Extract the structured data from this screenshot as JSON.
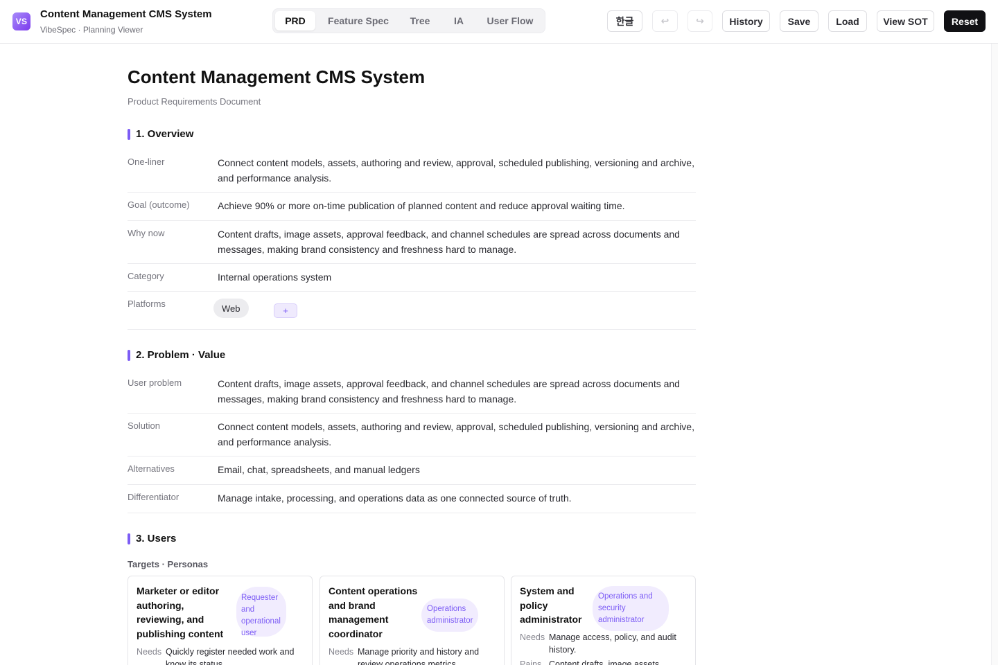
{
  "app": {
    "logo": "VS",
    "title": "Content Management CMS System",
    "subtitle": "VibeSpec · Planning Viewer"
  },
  "tabs": [
    {
      "label": "PRD",
      "active": true
    },
    {
      "label": "Feature Spec",
      "active": false
    },
    {
      "label": "Tree",
      "active": false
    },
    {
      "label": "IA",
      "active": false
    },
    {
      "label": "User Flow",
      "active": false
    }
  ],
  "toolbar": {
    "language": "한글",
    "undo_icon": "↩",
    "redo_icon": "↪",
    "history": "History",
    "save": "Save",
    "load": "Load",
    "view_sot": "View SOT",
    "reset": "Reset"
  },
  "doc": {
    "title": "Content Management CMS System",
    "subtitle": "Product Requirements Document"
  },
  "overview": {
    "heading": "1. Overview",
    "rows": [
      {
        "label": "One-liner",
        "value": "Connect content models, assets, authoring and review, approval, scheduled publishing, versioning and archive, and performance analysis."
      },
      {
        "label": "Goal (outcome)",
        "value": "Achieve 90% or more on-time publication of planned content and reduce approval waiting time."
      },
      {
        "label": "Why now",
        "value": "Content drafts, image assets, approval feedback, and channel schedules are spread across documents and messages, making brand consistency and freshness hard to manage."
      },
      {
        "label": "Category",
        "value": "Internal operations system"
      }
    ],
    "platforms_label": "Platforms",
    "platforms": [
      "Web"
    ],
    "add_platform": "+"
  },
  "problem": {
    "heading": "2. Problem · Value",
    "rows": [
      {
        "label": "User problem",
        "value": "Content drafts, image assets, approval feedback, and channel schedules are spread across documents and messages, making brand consistency and freshness hard to manage."
      },
      {
        "label": "Solution",
        "value": "Connect content models, assets, authoring and review, approval, scheduled publishing, versioning and archive, and performance analysis."
      },
      {
        "label": "Alternatives",
        "value": "Email, chat, spreadsheets, and manual ledgers"
      },
      {
        "label": "Differentiator",
        "value": "Manage intake, processing, and operations data as one connected source of truth."
      }
    ]
  },
  "users": {
    "heading": "3. Users",
    "subheading": "Targets · Personas",
    "personas": [
      {
        "title": "Marketer or editor authoring, reviewing, and publishing content",
        "badge": "Requester and operational user",
        "needs_label": "Needs",
        "needs": "Quickly register needed work and know its status.",
        "extra_label": "",
        "extra": ""
      },
      {
        "title": "Content operations and brand management coordinator",
        "badge": "Operations administrator",
        "needs_label": "Needs",
        "needs": "Manage priority and history and review operations metrics.",
        "extra_label": "",
        "extra": ""
      },
      {
        "title": "System and policy administrator",
        "badge": "Operations and security administrator",
        "needs_label": "Needs",
        "needs": "Manage access, policy, and audit history.",
        "extra_label": "Pains",
        "extra": "Content drafts, image assets"
      }
    ]
  }
}
